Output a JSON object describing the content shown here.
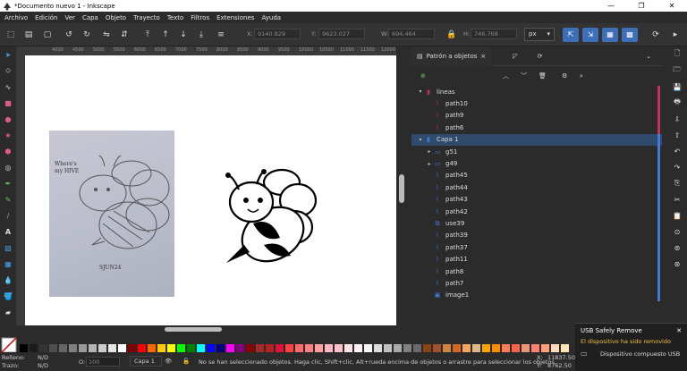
{
  "window": {
    "title": "*Documento nuevo 1 - Inkscape",
    "min": "—",
    "max": "❐",
    "close": "✕"
  },
  "menu": [
    "Archivo",
    "Edición",
    "Ver",
    "Capa",
    "Objeto",
    "Trayecto",
    "Texto",
    "Filtros",
    "Extensiones",
    "Ayuda"
  ],
  "toolbar": {
    "x_label": "X:",
    "x_value": "9140.829",
    "y_label": "Y:",
    "y_value": "9623.027",
    "w_label": "W:",
    "w_value": "694.464",
    "h_label": "H:",
    "h_value": "746.768",
    "unit": "px"
  },
  "ruler": {
    "ticks": [
      "4000",
      "4500",
      "5000",
      "5500",
      "6000",
      "6500",
      "7000",
      "7500",
      "8000",
      "8500",
      "9000",
      "9500",
      "10000",
      "10500",
      "11000",
      "11500",
      "12000"
    ]
  },
  "photo": {
    "text1": "Where's",
    "text2": "my HIVE",
    "text3": "SJUN24"
  },
  "panel": {
    "tab_label": "Patrón a objetos",
    "tab_close": "×",
    "tree": [
      {
        "label": "lineas",
        "type": "layer",
        "expanded": true,
        "indent": 0,
        "color": "#c8325a"
      },
      {
        "label": "path10",
        "type": "path",
        "indent": 1,
        "color": "#c8325a"
      },
      {
        "label": "path9",
        "type": "path",
        "indent": 1,
        "color": "#c8325a"
      },
      {
        "label": "path6",
        "type": "path",
        "indent": 1,
        "color": "#c8325a"
      },
      {
        "label": "Capa 1",
        "type": "layer",
        "expanded": true,
        "indent": 0,
        "color": "#3f7bd6",
        "selected": true
      },
      {
        "label": "g51",
        "type": "group",
        "indent": 1,
        "color": "#3f7bd6"
      },
      {
        "label": "g49",
        "type": "group",
        "indent": 1,
        "color": "#3f7bd6"
      },
      {
        "label": "path45",
        "type": "path",
        "indent": 1,
        "color": "#3f7bd6"
      },
      {
        "label": "path44",
        "type": "path",
        "indent": 1,
        "color": "#3f7bd6"
      },
      {
        "label": "path43",
        "type": "path",
        "indent": 1,
        "color": "#3f7bd6"
      },
      {
        "label": "path42",
        "type": "path",
        "indent": 1,
        "color": "#3f7bd6"
      },
      {
        "label": "use39",
        "type": "clone",
        "indent": 1,
        "color": "#3f7bd6"
      },
      {
        "label": "path39",
        "type": "path",
        "indent": 1,
        "color": "#3f7bd6"
      },
      {
        "label": "path37",
        "type": "path",
        "indent": 1,
        "color": "#3f7bd6"
      },
      {
        "label": "path11",
        "type": "path",
        "indent": 1,
        "color": "#3f7bd6"
      },
      {
        "label": "path8",
        "type": "path",
        "indent": 1,
        "color": "#3f7bd6"
      },
      {
        "label": "path7",
        "type": "path",
        "indent": 1,
        "color": "#3f7bd6"
      },
      {
        "label": "image1",
        "type": "image",
        "indent": 1,
        "color": "#3f7bd6"
      }
    ]
  },
  "palette_colors": [
    "#000000",
    "#1a1a1a",
    "#333333",
    "#4d4d4d",
    "#666666",
    "#808080",
    "#999999",
    "#b3b3b3",
    "#cccccc",
    "#e6e6e6",
    "#ffffff",
    "#800000",
    "#ff0000",
    "#ff6600",
    "#ffcc00",
    "#ffff00",
    "#00ff00",
    "#008000",
    "#00ffff",
    "#0000ff",
    "#000080",
    "#ff00ff",
    "#800080",
    "#8b0000",
    "#a52a2a",
    "#b22222",
    "#dc143c",
    "#ff4040",
    "#ff6a6a",
    "#ff8080",
    "#ffa0a0",
    "#ffb6c1",
    "#ffc0cb",
    "#ffe4e1",
    "#fff0f5",
    "#f5f5f5",
    "#dcdcdc",
    "#c0c0c0",
    "#a9a9a9",
    "#808080",
    "#696969",
    "#8b4513",
    "#a0522d",
    "#cd853f",
    "#d2691e",
    "#f4a460",
    "#deb887",
    "#ffa500",
    "#ff8c00",
    "#ff7f50",
    "#ff6347",
    "#e9967a",
    "#fa8072",
    "#ffa07a",
    "#ffdab9",
    "#ffe4b5"
  ],
  "status": {
    "fill_label": "Relleno:",
    "fill_value": "N/D",
    "stroke_label": "Trazo:",
    "stroke_value": "N/D",
    "opacity_label": "O:",
    "opacity_value": "100",
    "layer": "Capa 1",
    "message": "No se han seleccionado objetos. Haga clic, Shift+clic, Alt+rueda encima de objetos o arrastre para seleccionar los objetos.",
    "x_label": "X:",
    "x_value": "11837.50",
    "y_label": "Y:",
    "y_value": "8762.50"
  },
  "toast": {
    "title": "USB Safely Remove",
    "message": "El dispositivo ha sido removido",
    "device": "Dispositivo compuesto USB",
    "close": "✕"
  }
}
